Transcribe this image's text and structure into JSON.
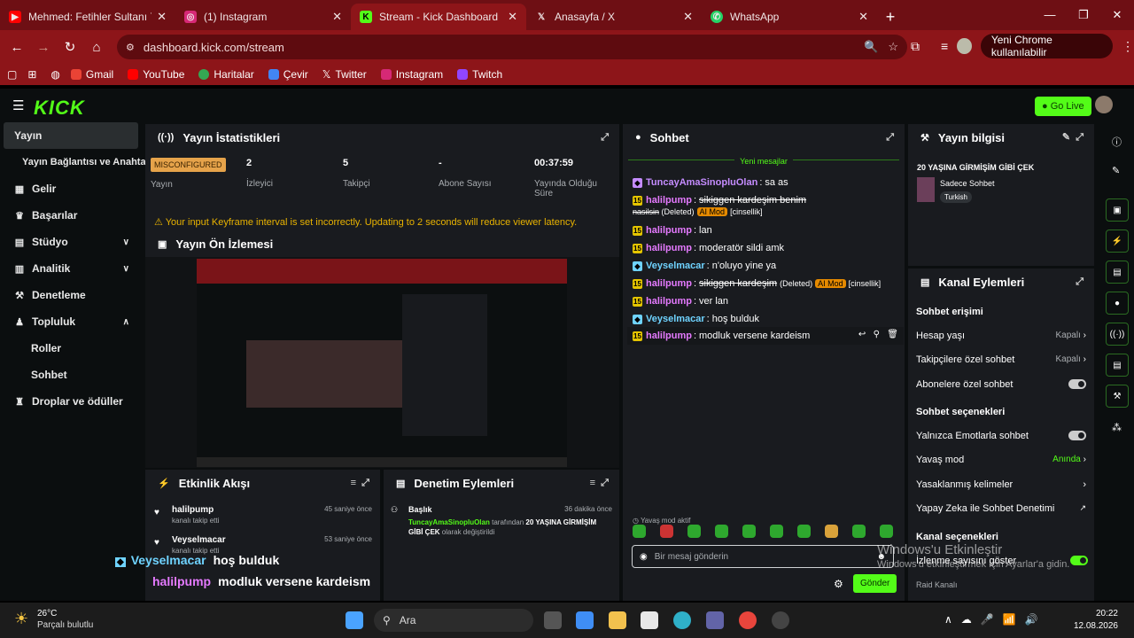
{
  "browser": {
    "tabs": [
      {
        "title": "Mehmed: Fetihler Sultanı 7",
        "color": "#ff0000"
      },
      {
        "title": "(1) Instagram",
        "color": "#d62976"
      },
      {
        "title": "Stream - Kick Dashboard",
        "color": "#53fc18"
      },
      {
        "title": "Anasayfa / X",
        "color": "#000000"
      },
      {
        "title": "WhatsApp",
        "color": "#25d366"
      }
    ],
    "url": "dashboard.kick.com/stream",
    "profile_label": "Yeni Chrome kullanılabilir",
    "bookmarks": [
      "Gmail",
      "YouTube",
      "Haritalar",
      "Çevir",
      "Twitter",
      "Instagram",
      "Twitch"
    ]
  },
  "kick": {
    "logo": "KICK",
    "golive": "Go Live",
    "sidebar": [
      {
        "label": "Yayın",
        "icon": "broadcast-icon",
        "active": true
      },
      {
        "label": "Yayın Bağlantısı ve Anahtarı",
        "sub": true
      },
      {
        "label": "Gelir",
        "icon": "revenue-icon"
      },
      {
        "label": "Başarılar",
        "icon": "trophy-icon"
      },
      {
        "label": "Stüdyo",
        "icon": "studio-icon",
        "chevron": "down"
      },
      {
        "label": "Analitik",
        "icon": "analytics-icon",
        "chevron": "down"
      },
      {
        "label": "Denetleme",
        "icon": "moderation-icon"
      },
      {
        "label": "Topluluk",
        "icon": "community-icon",
        "chevron": "up"
      },
      {
        "label": "Roller",
        "sub": true
      },
      {
        "label": "Sohbet",
        "sub": true
      },
      {
        "label": "Droplar ve ödüller",
        "icon": "drops-icon"
      }
    ],
    "stats": {
      "title": "Yayın İstatistikleri",
      "status_badge": "MISCONFIGURED",
      "status_label": "Yayın",
      "items": [
        {
          "value": "2",
          "label": "İzleyici"
        },
        {
          "value": "5",
          "label": "Takipçi"
        },
        {
          "value": "-",
          "label": "Abone Sayısı"
        },
        {
          "value": "00:37:59",
          "label": "Yayında Olduğu Süre"
        }
      ],
      "warning": "Your input Keyframe interval is set incorrectly. Updating to 2 seconds will reduce viewer latency."
    },
    "preview": {
      "title": "Yayın Ön İzlemesi"
    },
    "activity": {
      "title": "Etkinlik Akışı",
      "items": [
        {
          "user": "halilpump",
          "text": "kanalı takip etti",
          "time": "45 saniye önce"
        },
        {
          "user": "Veyselmacar",
          "text": "kanalı takip etti",
          "time": "53 saniye önce"
        }
      ]
    },
    "modlog": {
      "title": "Denetim Eylemleri",
      "item_title": "Başlık",
      "time": "36 dakika önce",
      "user": "TuncayAmaSinopluOlan",
      "mid": "tarafından",
      "value": "20 YAŞINA GİRMİŞİM GİBİ ÇEK",
      "end": "olarak değiştirildi"
    },
    "chat": {
      "title": "Sohbet",
      "new_messages": "Yeni mesajlar",
      "messages": [
        {
          "user": "TuncayAmaSinopluOlan",
          "text": "sa as",
          "color": "#c58cff"
        },
        {
          "user": "halilpump",
          "text": "sikiggen kardeşim benim",
          "text2": "nasilsin",
          "deleted": "(Deleted)",
          "mod": "AI Mod",
          "tag": "[cinsellik]",
          "color": "#e57aff"
        },
        {
          "user": "halilpump",
          "text": "lan",
          "color": "#e57aff"
        },
        {
          "user": "halilpump",
          "text": "moderatör sildi amk",
          "color": "#e57aff"
        },
        {
          "user": "Veyselmacar",
          "text": "n'oluyo yine ya",
          "color": "#6fd3ff"
        },
        {
          "user": "halilpump",
          "text": "sikiggen kardeşim",
          "deleted": "(Deleted)",
          "mod": "AI Mod",
          "tag": "[cinsellik]",
          "color": "#e57aff"
        },
        {
          "user": "halilpump",
          "text": "ver lan",
          "color": "#e57aff"
        },
        {
          "user": "Veyselmacar",
          "text": "hoş bulduk",
          "color": "#6fd3ff"
        },
        {
          "user": "halilpump",
          "text": "modluk versene kardeism",
          "color": "#e57aff"
        }
      ],
      "slow_mode": "Yavaş mod aktif",
      "input_placeholder": "Bir mesaj gönderin",
      "send": "Gönder"
    },
    "info": {
      "title": "Yayın bilgisi",
      "stream_title": "20 YAŞINA GİRMİŞİM GİBİ ÇEK",
      "category": "Sadece Sohbet",
      "tag": "Turkish"
    },
    "channel": {
      "title": "Kanal Eylemleri",
      "sec1": "Sohbet erişimi",
      "rows1": [
        {
          "label": "Hesap yaşı",
          "value": "Kapalı",
          "kind": "chev"
        },
        {
          "label": "Takipçilere özel sohbet",
          "value": "Kapalı",
          "kind": "chev"
        },
        {
          "label": "Abonelere özel sohbet",
          "kind": "toggle"
        }
      ],
      "sec2": "Sohbet seçenekleri",
      "rows2": [
        {
          "label": "Yalnızca Emotlarla sohbet",
          "kind": "toggle"
        },
        {
          "label": "Yavaş mod",
          "value": "Anında",
          "kind": "chev",
          "green": true
        },
        {
          "label": "Yasaklanmış kelimeler",
          "kind": "chev"
        },
        {
          "label": "Yapay Zeka ile Sohbet Denetimi",
          "kind": "ext"
        }
      ],
      "sec3": "Kanal seçenekleri",
      "rows3": [
        {
          "label": "İzlenme sayısını göster",
          "kind": "toggle-on"
        },
        {
          "label": "Raid Kanalı",
          "kind": "none"
        }
      ]
    },
    "overlay": [
      {
        "user": "Veyselmacar",
        "text": "hoş bulduk",
        "color": "#6fd3ff"
      },
      {
        "user": "halilpump",
        "text": "modluk versene kardeism",
        "color": "#e57aff"
      }
    ],
    "watermark1": "Windows'u Etkinleştir",
    "watermark2": "Windows'u etkinleştirmek için Ayarlar'a gidin."
  },
  "taskbar": {
    "temp": "26°C",
    "weather": "Parçalı bulutlu",
    "search": "Ara",
    "time": "20:22",
    "date": "12.08.2026"
  }
}
